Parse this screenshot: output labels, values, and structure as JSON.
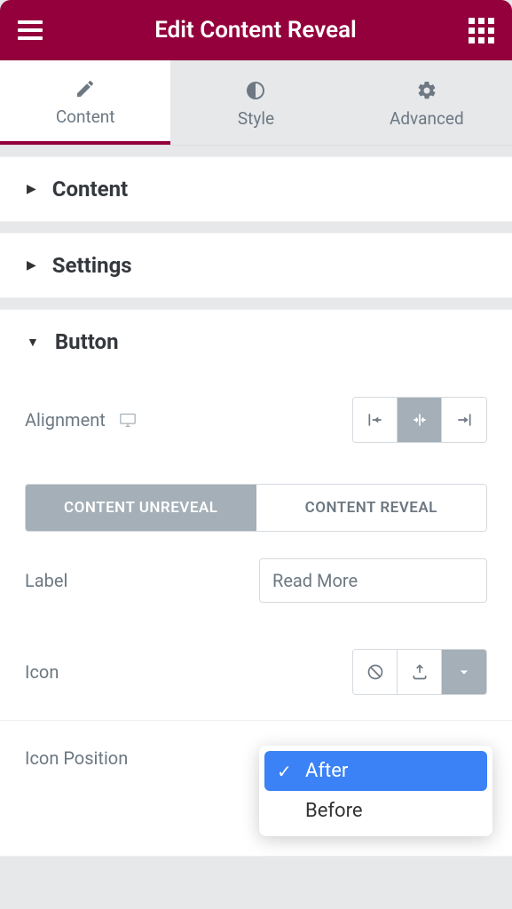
{
  "header": {
    "title": "Edit Content Reveal"
  },
  "tabs": {
    "content": "Content",
    "style": "Style",
    "advanced": "Advanced",
    "active": "content"
  },
  "sections": {
    "content": {
      "title": "Content",
      "expanded": false
    },
    "settings": {
      "title": "Settings",
      "expanded": false
    },
    "button": {
      "title": "Button",
      "expanded": true
    }
  },
  "button_panel": {
    "alignment_label": "Alignment",
    "alignment_value": "center",
    "toggle": {
      "unreveal": "CONTENT UNREVEAL",
      "reveal": "CONTENT REVEAL",
      "active": "unreveal"
    },
    "label_field": {
      "label": "Label",
      "value": "Read More"
    },
    "icon_label": "Icon",
    "icon_position": {
      "label": "Icon Position",
      "options": [
        "After",
        "Before"
      ],
      "selected": "After"
    }
  }
}
